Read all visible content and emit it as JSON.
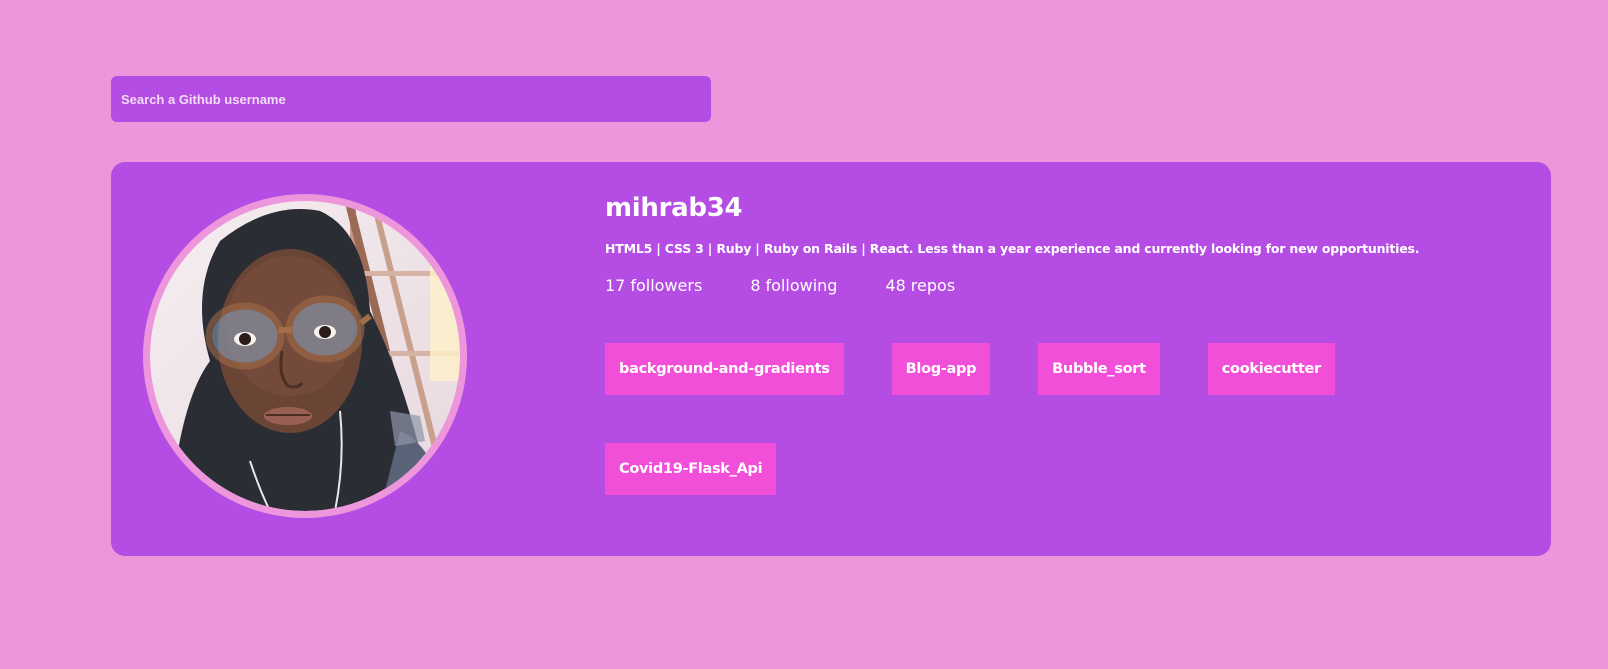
{
  "search": {
    "placeholder": "Search a Github username",
    "value": ""
  },
  "profile": {
    "username": "mihrab34",
    "bio": "HTML5 | CSS 3 | Ruby | Ruby on Rails | React. Less than a year experience and currently looking for new opportunities.",
    "avatar_alt": "mihrab34",
    "stats": {
      "followers_count": "17",
      "followers_label": "followers",
      "following_count": "8",
      "following_label": "following",
      "repos_count": "48",
      "repos_label": "repos"
    }
  },
  "repos": [
    {
      "name": "background-and-gradients"
    },
    {
      "name": "Blog-app"
    },
    {
      "name": "Bubble_sort"
    },
    {
      "name": "cookiecutter"
    },
    {
      "name": "Covid19-Flask_Api"
    }
  ],
  "colors": {
    "page_background": "#ed96dc",
    "card_background": "#b54ce3",
    "repo_button": "#f24fd8",
    "text": "#ffffff"
  },
  "icons": {
    "avatar": "user-photo"
  }
}
